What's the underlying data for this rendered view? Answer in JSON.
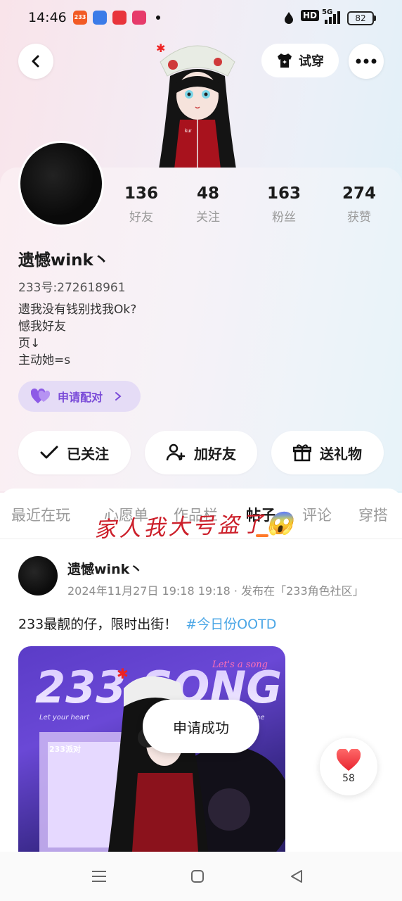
{
  "status_bar": {
    "time": "14:46",
    "apps": [
      {
        "name": "233-app-icon",
        "text": "233",
        "color": "#f25a24"
      },
      {
        "name": "blue-app-icon",
        "text": "",
        "color": "#3b7be8"
      },
      {
        "name": "red-app-icon",
        "text": "",
        "color": "#e8343b"
      },
      {
        "name": "pink-app-icon",
        "text": "",
        "color": "#e63a6a"
      }
    ],
    "hd": "HD",
    "signal": "5G",
    "battery": "82"
  },
  "header": {
    "back_label": "",
    "tryon_label": "试穿",
    "more_label": ""
  },
  "profile": {
    "stats": [
      {
        "value": "136",
        "label": "好友"
      },
      {
        "value": "48",
        "label": "关注"
      },
      {
        "value": "163",
        "label": "粉丝"
      },
      {
        "value": "274",
        "label": "获赞"
      }
    ],
    "username": "遗憾wink丶",
    "uid": "233号:272618961",
    "bio": [
      "遗我没有钱别找我Ok?",
      "憾我好友",
      "页↓",
      "主动她=s"
    ],
    "pair_label": "申请配对"
  },
  "actions": {
    "followed": "已关注",
    "add_friend": "加好友",
    "send_gift": "送礼物"
  },
  "tabs": [
    "最近在玩",
    "心愿单",
    "作品栏",
    "帖子",
    "评论",
    "穿搭"
  ],
  "active_tab": "帖子",
  "overlay_handwriting": "家人我大号盗了😱",
  "post": {
    "username": "遗憾wink丶",
    "meta": "2024年11月27日 19:18 19:18 · 发布在「233角色社区」",
    "text": "233最靓的仔，限时出街！",
    "hashtag": "#今日份OOTD",
    "image": {
      "title": "233 SONG",
      "subtitle_left": "Let your heart",
      "subtitle_right": "ne",
      "script_text": "Let's a song",
      "badge": "233派对"
    }
  },
  "toast": "申请成功",
  "like": {
    "count": "58"
  },
  "colors": {
    "accent_purple": "#7a4bd8",
    "hashtag_blue": "#4aa6e6",
    "tab_underline": "#ff7a29",
    "handwriting_red": "#cc1f2a"
  }
}
